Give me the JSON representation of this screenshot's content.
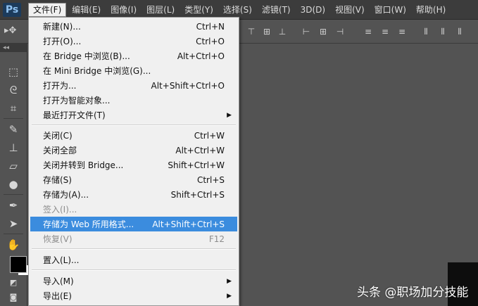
{
  "app": {
    "logo": "Ps"
  },
  "menubar": [
    {
      "label": "文件(F)",
      "active": true
    },
    {
      "label": "编辑(E)"
    },
    {
      "label": "图像(I)"
    },
    {
      "label": "图层(L)"
    },
    {
      "label": "类型(Y)"
    },
    {
      "label": "选择(S)"
    },
    {
      "label": "滤镜(T)"
    },
    {
      "label": "3D(D)"
    },
    {
      "label": "视图(V)"
    },
    {
      "label": "窗口(W)"
    },
    {
      "label": "帮助(H)"
    }
  ],
  "file_menu": [
    {
      "label": "新建(N)...",
      "shortcut": "Ctrl+N"
    },
    {
      "label": "打开(O)...",
      "shortcut": "Ctrl+O"
    },
    {
      "label": "在 Bridge 中浏览(B)...",
      "shortcut": "Alt+Ctrl+O"
    },
    {
      "label": "在 Mini Bridge 中浏览(G)...",
      "shortcut": ""
    },
    {
      "label": "打开为...",
      "shortcut": "Alt+Shift+Ctrl+O"
    },
    {
      "label": "打开为智能对象...",
      "shortcut": ""
    },
    {
      "label": "最近打开文件(T)",
      "shortcut": "",
      "submenu": true
    },
    {
      "label": "关闭(C)",
      "shortcut": "Ctrl+W"
    },
    {
      "label": "关闭全部",
      "shortcut": "Alt+Ctrl+W"
    },
    {
      "label": "关闭并转到 Bridge...",
      "shortcut": "Shift+Ctrl+W"
    },
    {
      "label": "存储(S)",
      "shortcut": "Ctrl+S"
    },
    {
      "label": "存储为(A)...",
      "shortcut": "Shift+Ctrl+S"
    },
    {
      "label": "签入(I)...",
      "shortcut": "",
      "disabled": true
    },
    {
      "label": "存储为 Web 所用格式...",
      "shortcut": "Alt+Shift+Ctrl+S",
      "highlighted": true
    },
    {
      "label": "恢复(V)",
      "shortcut": "F12",
      "disabled": true
    },
    {
      "label": "置入(L)...",
      "shortcut": ""
    },
    {
      "label": "导入(M)",
      "shortcut": "",
      "submenu": true
    },
    {
      "label": "导出(E)",
      "shortcut": "",
      "submenu": true
    }
  ],
  "toolbar_grip": "◂◂",
  "watermark": "头条 @职场加分技能",
  "colors": {
    "highlight": "#3b8cde",
    "menu_bg": "#f0f0f0",
    "app_bg": "#535353"
  }
}
